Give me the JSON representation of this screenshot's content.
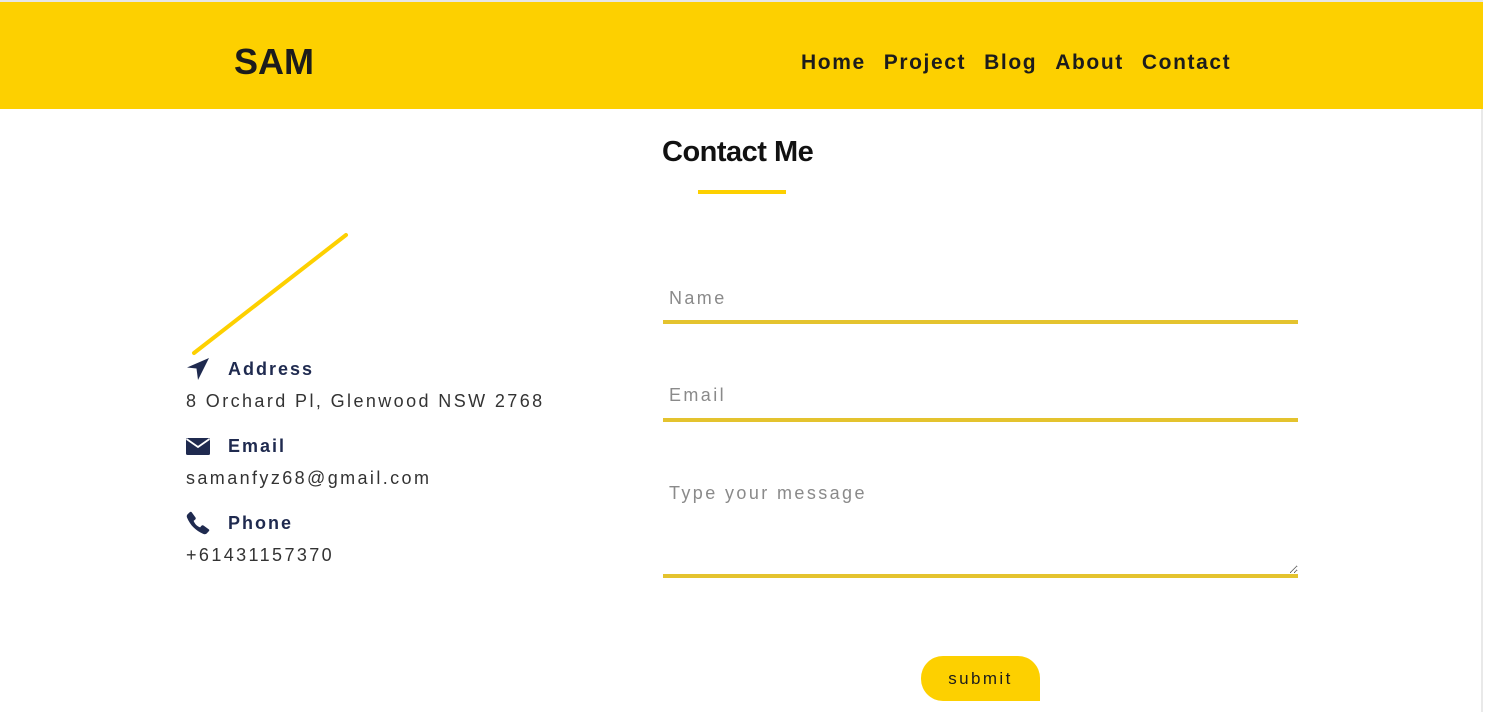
{
  "navbar": {
    "brand": "SAM",
    "links": [
      "Home",
      "Project",
      "Blog",
      "About",
      "Contact"
    ]
  },
  "contact": {
    "title": "Contact Me"
  },
  "info": {
    "address": {
      "label": "Address",
      "value": "8 Orchard Pl, Glenwood NSW 2768",
      "icon": "location-arrow-icon"
    },
    "email": {
      "label": "Email",
      "value": "samanfyz68@gmail.com",
      "icon": "envelope-icon"
    },
    "phone": {
      "label": "Phone",
      "value": "+61431157370",
      "icon": "phone-icon"
    }
  },
  "form": {
    "name_placeholder": "Name",
    "email_placeholder": "Email",
    "message_placeholder": "Type your message",
    "submit_label": "submit"
  },
  "colors": {
    "accent": "#fdd000",
    "field_border": "#e4c32e",
    "icon": "#1f2a4f",
    "text_dark": "#1c1c1c"
  }
}
